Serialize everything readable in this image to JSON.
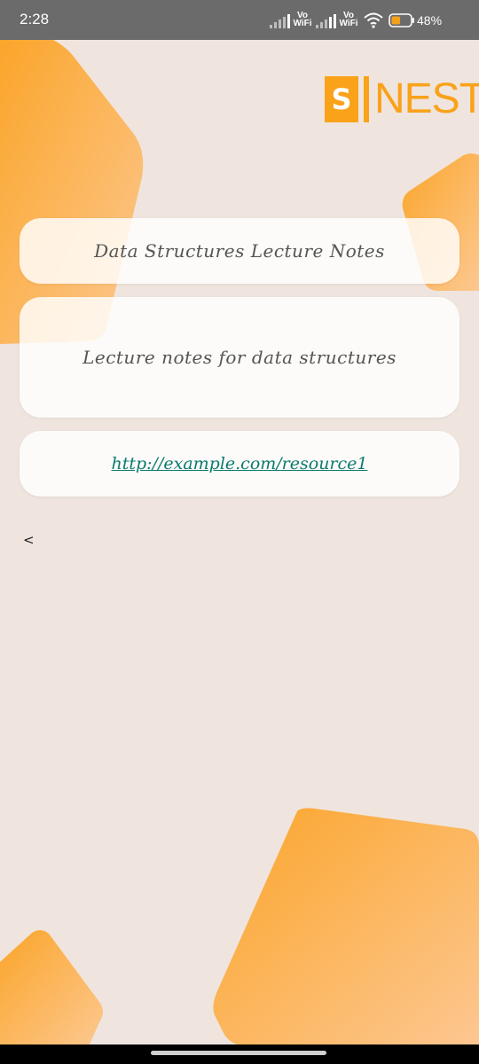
{
  "status_bar": {
    "time": "2:28",
    "vowifi_1": "Vo\nWiFi",
    "vowifi_2": "Vo\nWiFi",
    "battery_percent": "48%",
    "battery_level": 0.48
  },
  "brand": {
    "logo_letter": "S",
    "logo_text": "NEST",
    "accent_color": "#f9a21a"
  },
  "resource": {
    "title": "Data Structures Lecture Notes",
    "description": "Lecture notes for data structures",
    "link": "http://example.com/resource1"
  },
  "navigation": {
    "back_label": "<"
  },
  "icons": [
    "signal-icon",
    "wifi-icon",
    "battery-icon",
    "back-icon"
  ]
}
